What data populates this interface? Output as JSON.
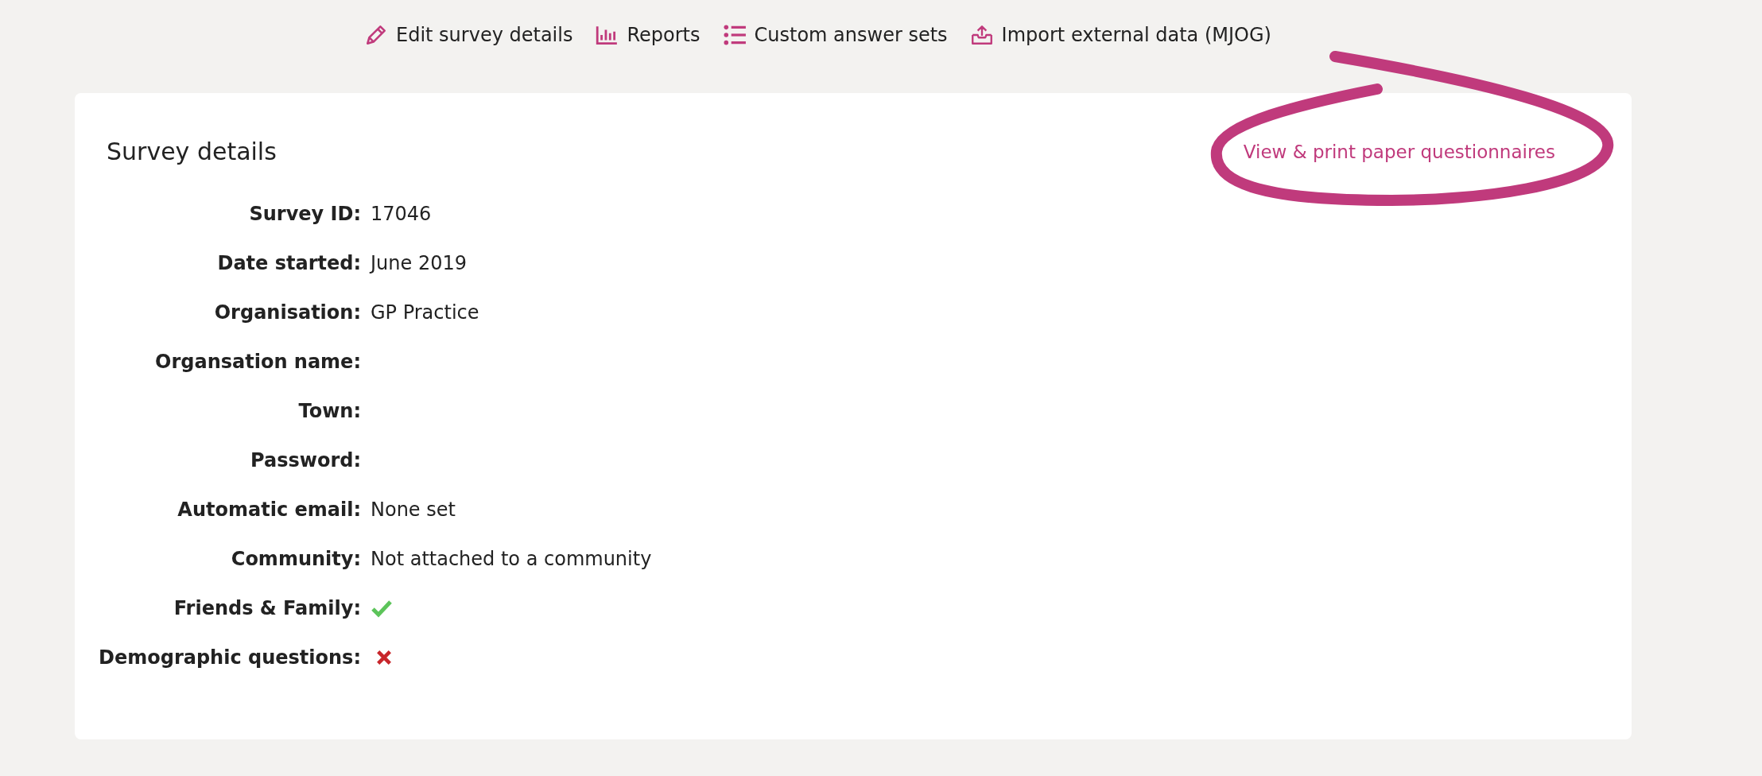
{
  "toolbar": [
    {
      "label": "Edit survey details"
    },
    {
      "label": "Reports"
    },
    {
      "label": "Custom answer sets"
    },
    {
      "label": "Import external data (MJOG)"
    }
  ],
  "card": {
    "title": "Survey details",
    "link": "View & print paper questionnaires",
    "rows": [
      {
        "kind": "text",
        "label": "Survey ID:",
        "value": "17046"
      },
      {
        "kind": "text",
        "label": "Date started:",
        "value": "June 2019"
      },
      {
        "kind": "text",
        "label": "Organisation:",
        "value": "GP Practice"
      },
      {
        "kind": "text",
        "label": "Organsation name:"
      },
      {
        "kind": "text",
        "label": "Town:"
      },
      {
        "kind": "text",
        "label": "Password:"
      },
      {
        "kind": "text",
        "label": "Automatic email:",
        "value": "None set"
      },
      {
        "kind": "text",
        "label": "Community:",
        "value": "Not attached to a community"
      },
      {
        "kind": "flag",
        "label": "Friends & Family:",
        "checked": true
      },
      {
        "kind": "flag",
        "label": "Demographic questions:",
        "checked": false
      }
    ]
  }
}
